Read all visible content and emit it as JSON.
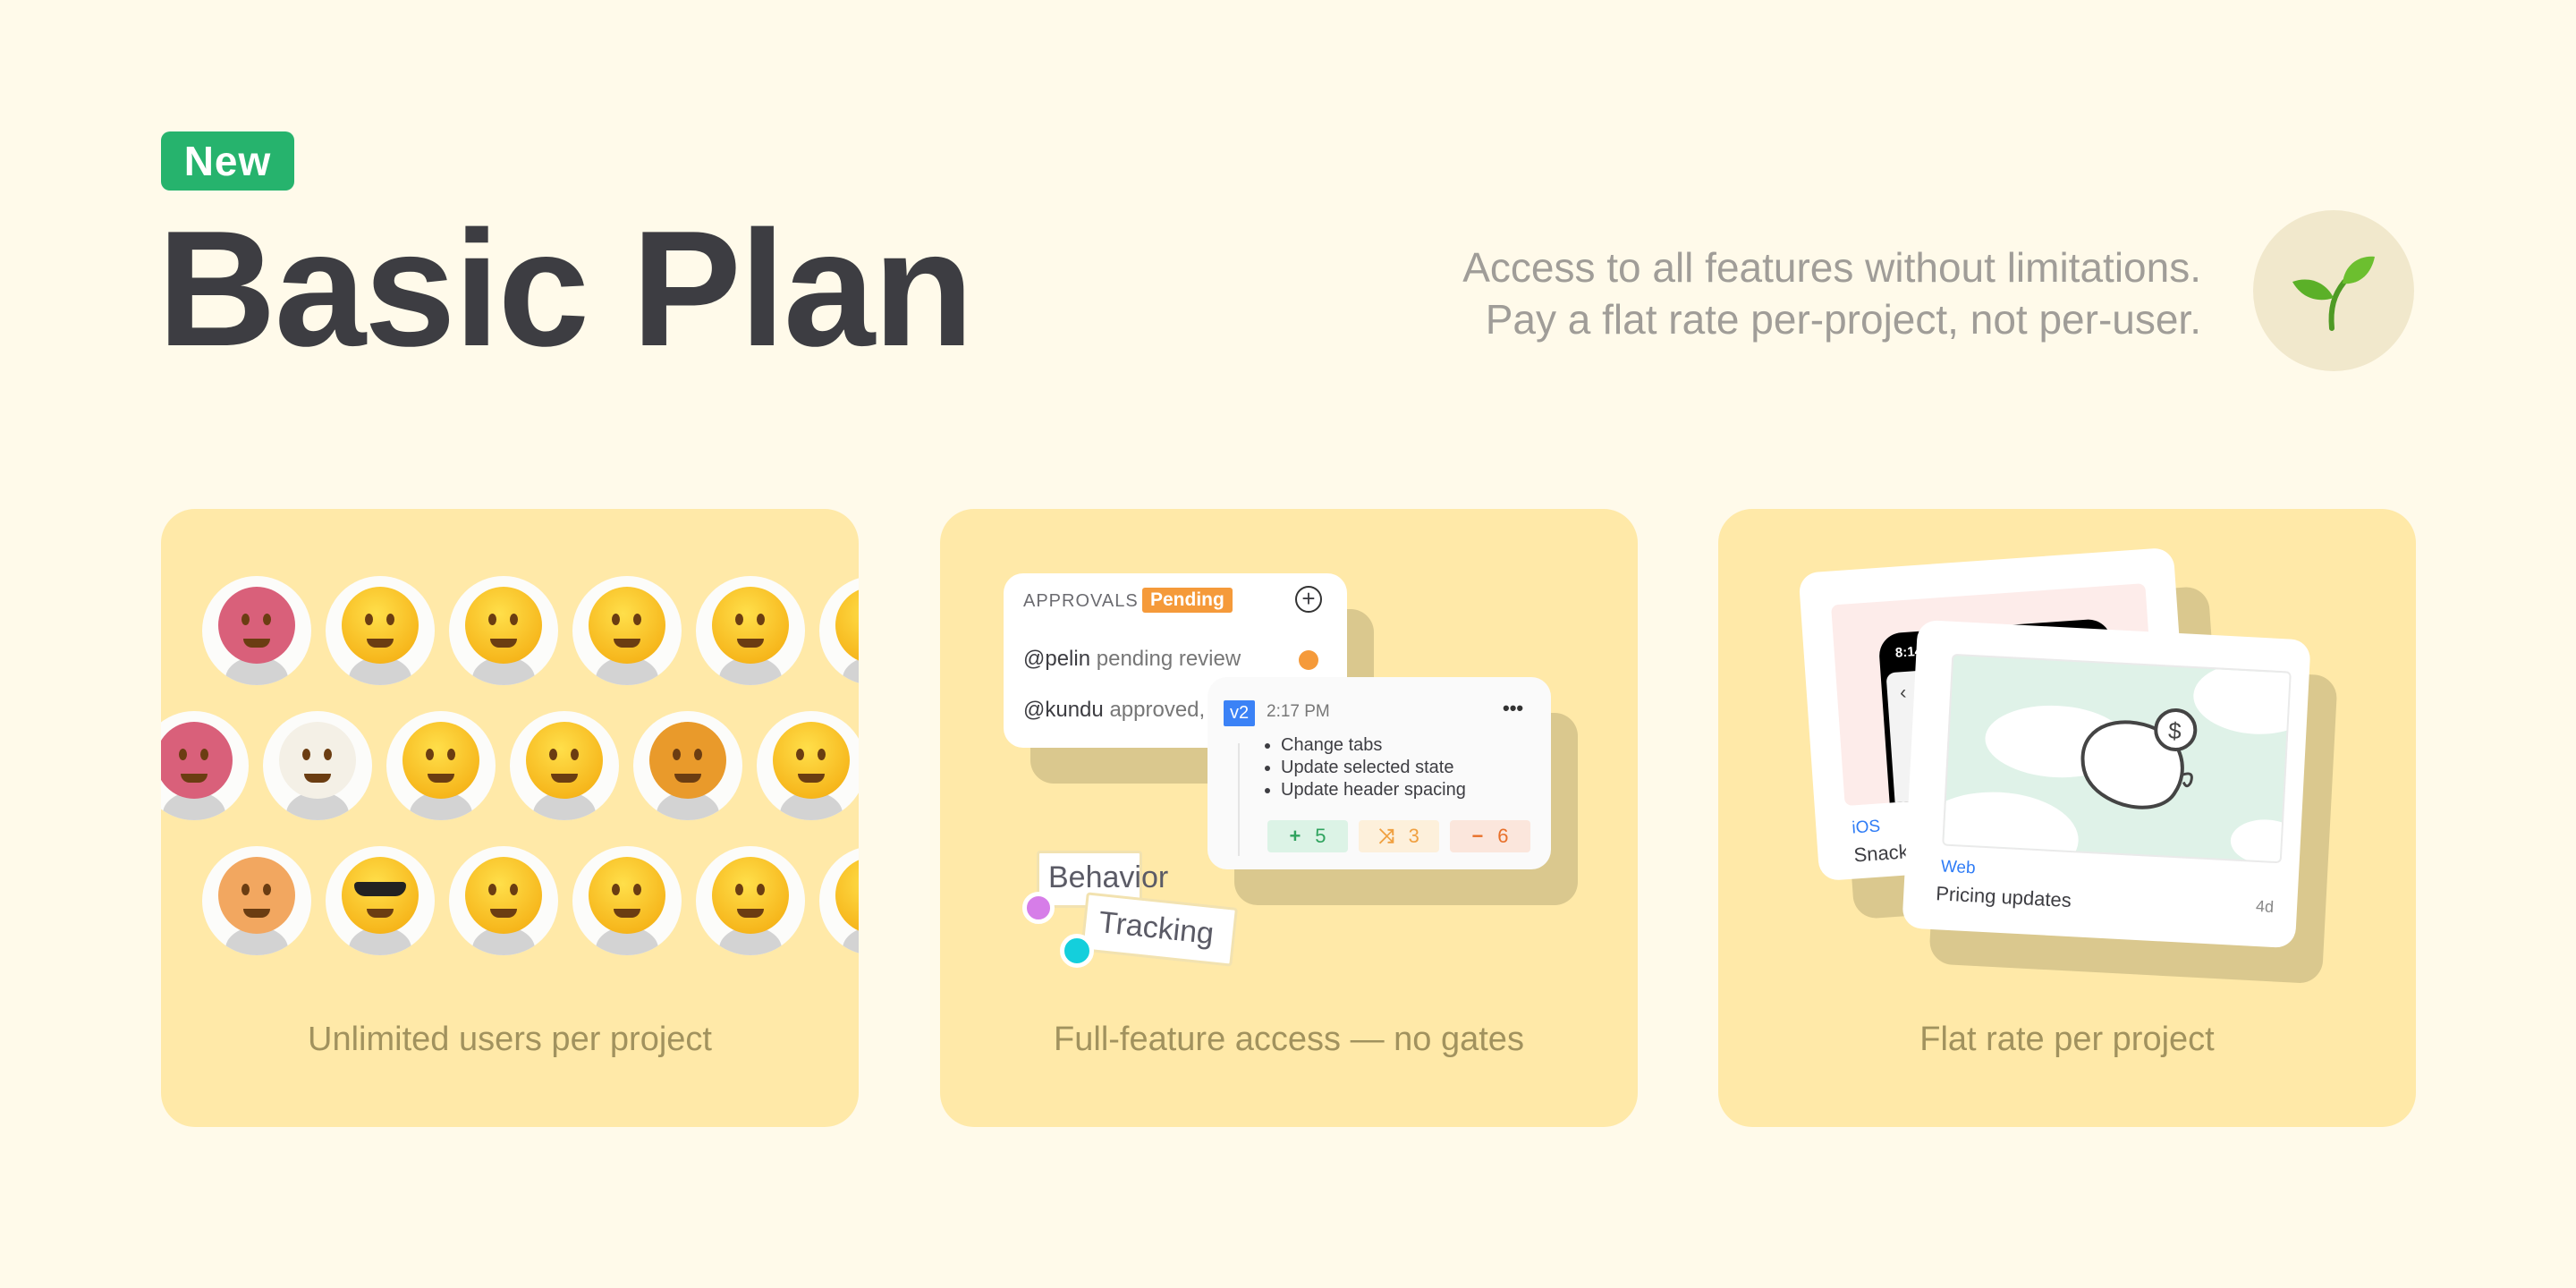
{
  "badge": "New",
  "title": "Basic Plan",
  "tagline": [
    "Access to all features without limitations.",
    "Pay a flat rate per-project, not per-user."
  ],
  "logo_icon": "sprout-icon",
  "colors": {
    "background": "#fffaea",
    "card": "#ffe9a8",
    "badge": "#26b36d",
    "pending": "#f59a3a",
    "version": "#3b82f6"
  },
  "cards": [
    {
      "caption": "Unlimited users per project",
      "avatar_rows": [
        [
          "octopus",
          "anguished-face",
          "grimacing-face",
          "face-with-thermometer",
          "full-moon-face",
          "face-with-head-bandage"
        ],
        [
          "octopus",
          "chicken",
          "grinning-face",
          "relieved-face",
          "lion",
          "frowning-face",
          "smiling-face"
        ],
        [
          "hamster",
          "smiling-face-with-sunglasses",
          "smirking-face",
          "thinking-face",
          "nerd-face",
          "unamused-face"
        ]
      ]
    },
    {
      "caption": "Full-feature access — no gates",
      "approvals": {
        "heading": "APPROVALS",
        "status": "Pending",
        "rows": [
          {
            "user": "@pelin",
            "text": "pending review"
          },
          {
            "user": "@kundu",
            "text": "approved,"
          }
        ]
      },
      "version": {
        "tag": "v2",
        "time": "2:17 PM",
        "changes": [
          "Change tabs",
          "Update selected state",
          "Update header spacing"
        ],
        "stats": {
          "added": "5",
          "modified": "3",
          "removed": "6"
        }
      },
      "tags": [
        "Behavior",
        "Tracking"
      ]
    },
    {
      "caption": "Flat rate per project",
      "back_item": {
        "platform": "iOS",
        "name": "Snack",
        "phone_time": "8:14"
      },
      "front_item": {
        "platform": "Web",
        "name": "Pricing updates",
        "age": "4d"
      }
    }
  ]
}
